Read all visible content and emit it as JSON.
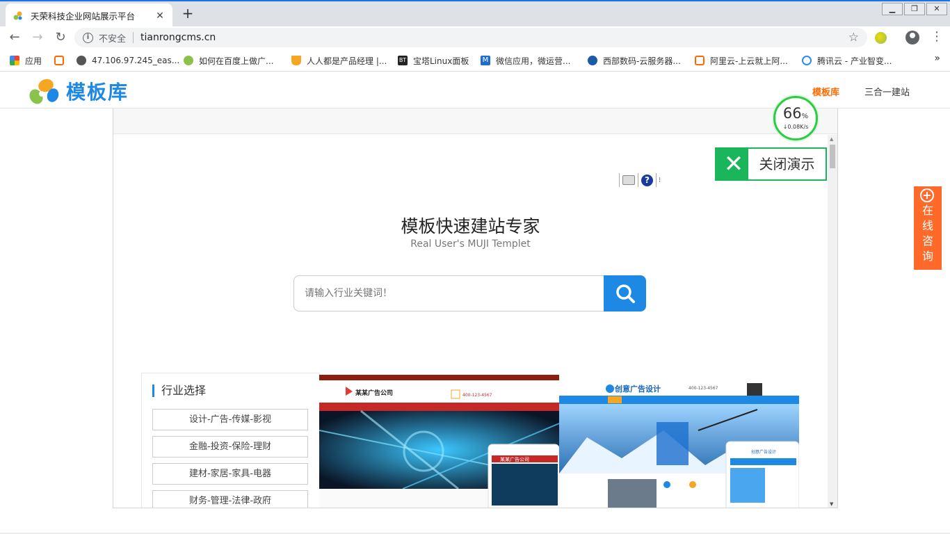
{
  "browser": {
    "tab_title": "天荣科技企业网站展示平台",
    "new_tab": "+",
    "close_tab": "✕",
    "security_label": "不安全",
    "url": "tianrongcms.cn"
  },
  "bookmarks": [
    {
      "label": "应用",
      "icon": "apps-grid-icon",
      "color": "#ea4335"
    },
    {
      "label": "",
      "icon": "aliyun-icon",
      "color": "#ff6a00"
    },
    {
      "label": "47.106.97.245_eas...",
      "icon": "globe-icon",
      "color": "#555555"
    },
    {
      "label": "如何在百度上做广...",
      "icon": "leaf-icon",
      "color": "#8bc34a"
    },
    {
      "label": "人人都是产品经理 |...",
      "icon": "woshipm-icon",
      "color": "#f5a623"
    },
    {
      "label": "宝塔Linux面板",
      "icon": "bt-icon",
      "color": "#222222"
    },
    {
      "label": "微信应用，微运营...",
      "icon": "m-icon",
      "color": "#1e6fc9"
    },
    {
      "label": "西部数码-云服务器...",
      "icon": "west-icon",
      "color": "#1a5aa8"
    },
    {
      "label": "阿里云-上云就上阿...",
      "icon": "aliyun-icon",
      "color": "#ff6a00"
    },
    {
      "label": "腾讯云 - 产业智变...",
      "icon": "tencent-cloud-icon",
      "color": "#2d8cf0"
    }
  ],
  "header": {
    "logo_text": "模板库",
    "nav": [
      {
        "label": "模板库",
        "active": true
      },
      {
        "label": "三合一建站",
        "active": false
      }
    ]
  },
  "speed_widget": {
    "percent": "66",
    "percent_sign": "%",
    "rate": "↓0.08K/s"
  },
  "close_demo": {
    "label": "关闭演示"
  },
  "consult": {
    "label": "在线咨询"
  },
  "hero": {
    "title": "模板快速建站专家",
    "subtitle": "Real User's MUJI Templet"
  },
  "search": {
    "placeholder": "请输入行业关键词！"
  },
  "industry": {
    "title": "行业选择",
    "items": [
      "设计-广告-传媒-影视",
      "金融-投资-保险-理财",
      "建材-家居-家具-电器",
      "财务-管理-法律-政府"
    ]
  },
  "templates": [
    {
      "company": "某某广告公司",
      "phone": "400-123-4567"
    },
    {
      "company": "创意广告设计",
      "phone": "400-123-4567"
    }
  ],
  "colors": {
    "accent": "#1e88e5",
    "nav_active": "#ff6a00",
    "close_green": "#1bb55c",
    "consult_orange": "#ff6a2b"
  }
}
